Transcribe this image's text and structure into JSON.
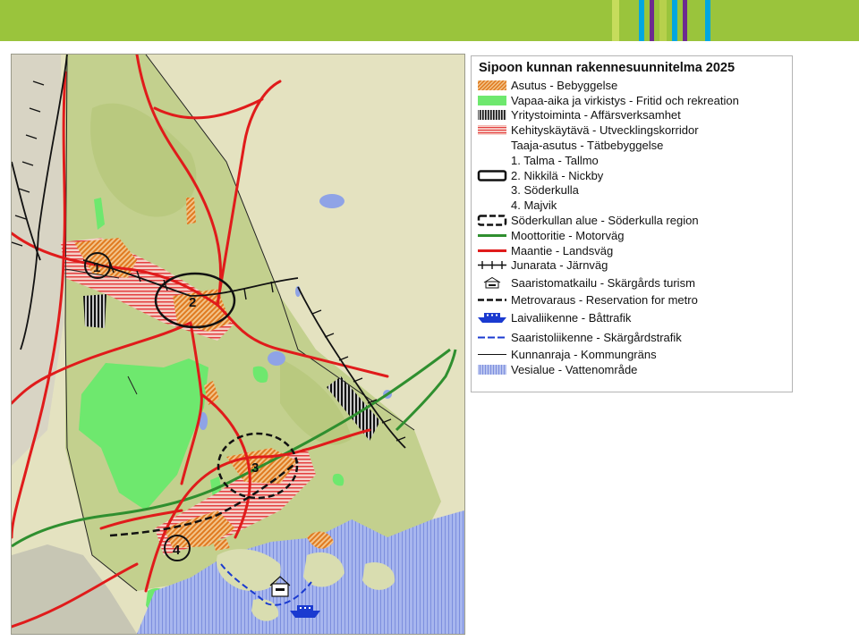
{
  "header": {
    "bar_color": "#9ac43c",
    "stripe_colors": [
      "#c6dc5c",
      "#9ac43c",
      "#00a7e1",
      "#6d2b8f",
      "#b7d04c",
      "#00a7e1",
      "#6d2b8f",
      "#9ac43c",
      "#00a7e1"
    ]
  },
  "map": {
    "markers": [
      {
        "label": "1"
      },
      {
        "label": "2"
      },
      {
        "label": "3"
      },
      {
        "label": "4"
      }
    ],
    "colors": {
      "land": "#e6e2b4",
      "forest": "#c9d48f",
      "recreation": "#6ee86e",
      "water": "#8fa3e6",
      "road": "#e01b1b",
      "motorway": "#2f8f2f",
      "settlement": "#e8a050"
    }
  },
  "legend": {
    "title": "Sipoon kunnan rakennesuunnitelma 2025",
    "items": [
      {
        "label": "Asutus - Bebyggelse",
        "symbol": "hatch-orange-icon"
      },
      {
        "label": "Vapaa-aika ja virkistys - Fritid och rekreation",
        "symbol": "green-area-icon"
      },
      {
        "label": "Yritystoiminta - Affärsverksamhet",
        "symbol": "black-hatch-icon"
      },
      {
        "label": "Kehityskäytävä - Utvecklingskorridor",
        "symbol": "red-hatch-icon"
      },
      {
        "label": "Taaja-asutus - Tätbebyggelse",
        "symbol": ""
      },
      {
        "label": "1. Talma - Tallmo",
        "symbol": ""
      },
      {
        "label": "2. Nikkilä - Nickby",
        "symbol": "black-box-icon"
      },
      {
        "label": "3. Söderkulla",
        "symbol": ""
      },
      {
        "label": "4. Majvik",
        "symbol": ""
      },
      {
        "label": "Söderkullan alue - Söderkulla region",
        "symbol": "dashed-box-icon"
      },
      {
        "label": "Moottoritie - Motorväg",
        "symbol": "green-line-icon"
      },
      {
        "label": "Maantie - Landsväg",
        "symbol": "red-line-icon"
      },
      {
        "label": "Junarata - Järnväg",
        "symbol": "railway-icon"
      },
      {
        "label": "Saaristomatkailu - Skärgårds turism",
        "symbol": "house-icon"
      },
      {
        "label": "Metrovaraus - Reservation for metro",
        "symbol": "dashed-line-icon"
      },
      {
        "label": "Laivaliikenne - Båttrafik",
        "symbol": "ship-icon"
      },
      {
        "label": "Saaristoliikenne - Skärgårdstrafik",
        "symbol": "blue-dash-icon"
      },
      {
        "label": "Kunnanraja - Kommungräns",
        "symbol": "thin-line-icon"
      },
      {
        "label": "Vesialue - Vattenområde",
        "symbol": "water-area-icon"
      }
    ]
  }
}
